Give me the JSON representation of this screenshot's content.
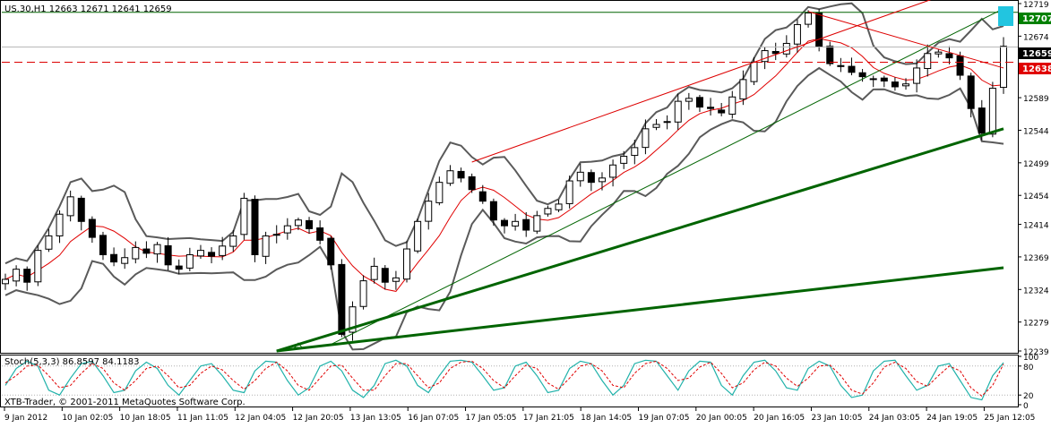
{
  "symbol_header": "US.30,H1  12663 12671 12641 12659",
  "stoch_header": "Stoch(5,3,3) 86.8597 84.1183",
  "copyright": "XTB-Trader, © 2001-2011 MetaQuotes Software Corp.",
  "colors": {
    "background": "#ffffff",
    "bull_candle": "#ffffff",
    "bear_candle": "#000000",
    "bollinger": "#5a5a5a",
    "ma_red": "#e00000",
    "trend_green": "#006400",
    "channel_green": "#006400",
    "channel_red": "#dd0000",
    "price_label_current": "#000000",
    "price_label_level": "#e00000",
    "price_label_top": "#008000",
    "stoch_main": "#20b2aa",
    "stoch_signal": "#e00000"
  },
  "price_axis": {
    "ticks": [
      "12719",
      "12674",
      "12629",
      "12589",
      "12544",
      "12499",
      "12454",
      "12414",
      "12369",
      "12324",
      "12279",
      "12239"
    ],
    "labels": {
      "top_line": "12707",
      "current": "12659",
      "level": "12638"
    }
  },
  "stoch_axis": {
    "ticks": [
      "100",
      "80",
      "20",
      "0"
    ]
  },
  "time_axis": {
    "ticks": [
      "9 Jan 2012",
      "10 Jan 02:05",
      "10 Jan 18:05",
      "11 Jan 11:05",
      "12 Jan 04:05",
      "12 Jan 20:05",
      "13 Jan 13:05",
      "16 Jan 07:05",
      "17 Jan 05:05",
      "17 Jan 21:05",
      "18 Jan 14:05",
      "19 Jan 07:05",
      "20 Jan 00:05",
      "20 Jan 16:05",
      "23 Jan 10:05",
      "24 Jan 03:05",
      "24 Jan 19:05",
      "25 Jan 12:05"
    ]
  },
  "chart_data": [
    {
      "type": "candlestick",
      "title": "US.30,H1",
      "ylim": [
        12239,
        12719
      ],
      "series": [
        {
          "name": "price (approx. close path)",
          "values": [
            12338,
            12352,
            12334,
            12378,
            12398,
            12428,
            12452,
            12418,
            12396,
            12372,
            12362,
            12368,
            12382,
            12374,
            12386,
            12358,
            12352,
            12372,
            12378,
            12370,
            12384,
            12398,
            12450,
            12372,
            12398,
            12400,
            12412,
            12420,
            12408,
            12392,
            12358,
            12262,
            12300,
            12336,
            12356,
            12334,
            12340,
            12380,
            12418,
            12446,
            12472,
            12488,
            12478,
            12462,
            12446,
            12420,
            12412,
            12418,
            12406,
            12426,
            12436,
            12442,
            12474,
            12486,
            12472,
            12478,
            12496,
            12508,
            12520,
            12546,
            12552,
            12556,
            12584,
            12588,
            12576,
            12574,
            12568,
            12590,
            12614,
            12638,
            12654,
            12650,
            12664,
            12690,
            12706,
            12660,
            12636,
            12632,
            12624,
            12618,
            12614,
            12612,
            12604,
            12608,
            12630,
            12650,
            12652,
            12644,
            12620,
            12574,
            12540,
            12602,
            12660
          ]
        }
      ],
      "levels": [
        12707,
        12638
      ],
      "annotations": [
        "12659 current price label",
        "12638 red dashed level",
        "12707 green horizontal line"
      ]
    },
    {
      "type": "line",
      "title": "Stoch(5,3,3)",
      "ylim": [
        0,
        100
      ],
      "series": [
        {
          "name": "Stoch main",
          "values": [
            40,
            75,
            90,
            80,
            30,
            20,
            55,
            85,
            90,
            60,
            25,
            30,
            70,
            88,
            75,
            40,
            20,
            50,
            80,
            85,
            60,
            30,
            25,
            70,
            90,
            88,
            50,
            20,
            35,
            80,
            90,
            70,
            30,
            15,
            40,
            85,
            92,
            80,
            40,
            25,
            60,
            90,
            92,
            88,
            60,
            30,
            35,
            80,
            88,
            60,
            25,
            30,
            75,
            90,
            85,
            50,
            20,
            40,
            85,
            92,
            90,
            60,
            30,
            70,
            90,
            88,
            40,
            20,
            60,
            88,
            92,
            70,
            35,
            30,
            75,
            90,
            80,
            40,
            15,
            20,
            70,
            90,
            92,
            60,
            30,
            40,
            80,
            85,
            50,
            15,
            10,
            60,
            87
          ]
        },
        {
          "name": "Stoch signal",
          "values": [
            45,
            60,
            80,
            82,
            60,
            35,
            40,
            65,
            85,
            75,
            45,
            30,
            50,
            75,
            80,
            60,
            35,
            40,
            65,
            80,
            72,
            50,
            32,
            50,
            75,
            88,
            70,
            40,
            30,
            55,
            80,
            82,
            55,
            30,
            30,
            60,
            85,
            85,
            60,
            35,
            45,
            75,
            88,
            90,
            75,
            50,
            35,
            60,
            82,
            75,
            45,
            32,
            55,
            80,
            85,
            70,
            40,
            35,
            65,
            85,
            90,
            75,
            50,
            55,
            78,
            88,
            65,
            35,
            45,
            72,
            88,
            80,
            55,
            38,
            55,
            80,
            82,
            60,
            30,
            22,
            45,
            78,
            88,
            75,
            48,
            38,
            60,
            80,
            70,
            35,
            18,
            40,
            84
          ]
        }
      ],
      "levels": [
        80,
        20
      ]
    }
  ]
}
